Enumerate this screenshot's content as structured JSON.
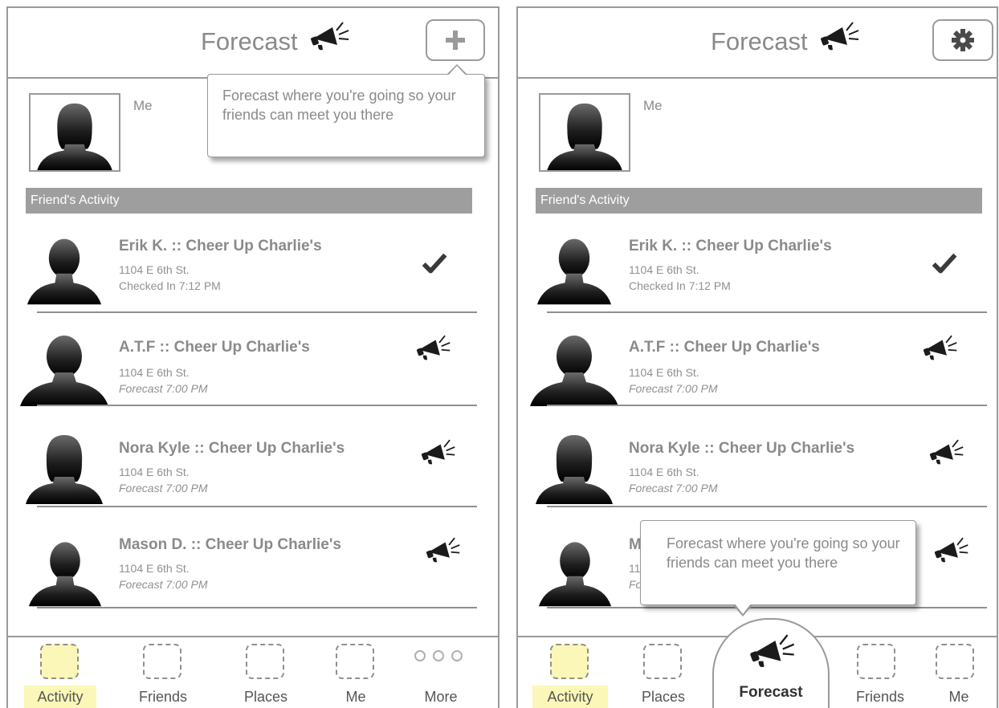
{
  "screens": [
    {
      "header": {
        "title": "Forecast",
        "button_icon": "plus-icon"
      },
      "me": {
        "label": "Me"
      },
      "section_title": "Friend's Activity",
      "tooltip": "Forecast where you're going so your friends can meet you there",
      "rows": [
        {
          "name": "Erik K. :: Cheer Up Charlie's",
          "address": "1104 E 6th St.",
          "status": "Checked In 7:12 PM",
          "icon": "checkmark-icon"
        },
        {
          "name": "A.T.F :: Cheer Up Charlie's",
          "address": "1104 E 6th St.",
          "status": "Forecast 7:00 PM",
          "icon": "megaphone-icon"
        },
        {
          "name": "Nora Kyle :: Cheer Up Charlie's",
          "address": "1104 E 6th St.",
          "status": "Forecast 7:00 PM",
          "icon": "megaphone-icon"
        },
        {
          "name": "Mason D. :: Cheer Up Charlie's",
          "address": "1104 E 6th St.",
          "status": "Forecast 7:00 PM",
          "icon": "megaphone-icon"
        }
      ],
      "tabs": [
        {
          "label": "Activity",
          "active": true
        },
        {
          "label": "Friends",
          "active": false
        },
        {
          "label": "Places",
          "active": false
        },
        {
          "label": "Me",
          "active": false
        },
        {
          "label": "More",
          "active": false
        }
      ]
    },
    {
      "header": {
        "title": "Forecast",
        "button_icon": "gear-icon"
      },
      "me": {
        "label": "Me"
      },
      "section_title": "Friend's Activity",
      "tooltip": "Forecast where you're going so your friends can meet you there",
      "rows": [
        {
          "name": "Erik K. :: Cheer Up Charlie's",
          "address": "1104 E 6th St.",
          "status": "Checked In 7:12 PM",
          "icon": "checkmark-icon"
        },
        {
          "name": "A.T.F :: Cheer Up Charlie's",
          "address": "1104 E 6th St.",
          "status": "Forecast 7:00 PM",
          "icon": "megaphone-icon"
        },
        {
          "name": "Nora Kyle :: Cheer Up Charlie's",
          "address": "1104 E 6th St.",
          "status": "Forecast 7:00 PM",
          "icon": "megaphone-icon"
        },
        {
          "name": "M",
          "address": "11",
          "status": "Fo",
          "icon": "megaphone-icon"
        }
      ],
      "tabs": [
        {
          "label": "Activity",
          "active": true
        },
        {
          "label": "Places",
          "active": false
        },
        {
          "label": "Forecast",
          "active": false
        },
        {
          "label": "Friends",
          "active": false
        },
        {
          "label": "Me",
          "active": false
        }
      ]
    }
  ],
  "colors": {
    "highlight": "#fbf7b8",
    "section_bar": "#9e9e9e",
    "border": "#9a9a9a"
  }
}
